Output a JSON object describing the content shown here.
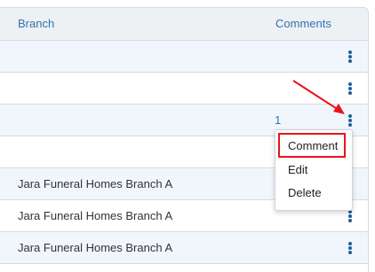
{
  "table": {
    "headers": {
      "branch": "Branch",
      "comments": "Comments"
    },
    "rows": [
      {
        "branch": "",
        "comments": ""
      },
      {
        "branch": "",
        "comments": ""
      },
      {
        "branch": "",
        "comments": "1"
      },
      {
        "branch": "",
        "comments": ""
      },
      {
        "branch": "Jara Funeral Homes Branch A",
        "comments": ""
      },
      {
        "branch": "Jara Funeral Homes Branch A",
        "comments": ""
      },
      {
        "branch": "Jara Funeral Homes Branch A",
        "comments": ""
      }
    ]
  },
  "context_menu": {
    "items": [
      "Comment",
      "Edit",
      "Delete"
    ],
    "highlighted": "Comment"
  },
  "colors": {
    "accent": "#2e73b0",
    "annotation": "#e8141c",
    "row_alt": "#f1f6fc"
  },
  "icons": {
    "row_action": "kebab-menu-icon"
  }
}
